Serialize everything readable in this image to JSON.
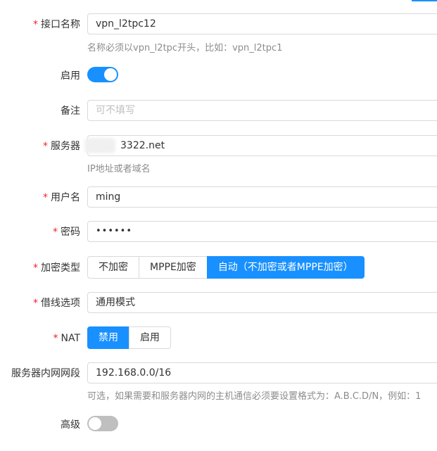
{
  "form": {
    "interface_name": {
      "label": "接口名称",
      "required": true,
      "value": "vpn_l2tpc12",
      "hint": "名称必须以vpn_l2tpc开头，比如：vpn_l2tpc1"
    },
    "enable": {
      "label": "启用",
      "required": false,
      "state": "on"
    },
    "remark": {
      "label": "备注",
      "required": false,
      "value": "",
      "placeholder": "可不填写"
    },
    "server": {
      "label": "服务器",
      "required": true,
      "value": "3322.net",
      "hint": "IP地址或者域名"
    },
    "username": {
      "label": "用户名",
      "required": true,
      "value": "ming"
    },
    "password": {
      "label": "密码",
      "required": true,
      "value": "••••••"
    },
    "encryption": {
      "label": "加密类型",
      "required": true,
      "options": [
        "不加密",
        "MPPE加密",
        "自动（不加密或者MPPE加密）"
      ],
      "selected": "自动（不加密或者MPPE加密）"
    },
    "line_option": {
      "label": "借线选项",
      "required": true,
      "value": "通用模式"
    },
    "nat": {
      "label": "NAT",
      "required": true,
      "options": [
        "禁用",
        "启用"
      ],
      "selected": "禁用"
    },
    "server_subnet": {
      "label": "服务器内网网段",
      "required": false,
      "value": "192.168.0.0/16",
      "hint": "可选，如果需要和服务器内网的主机通信必须要设置格式为：A.B.C.D/N，例如：1"
    },
    "advanced": {
      "label": "高级",
      "required": false,
      "state": "off"
    }
  },
  "required_marker": "*",
  "colors": {
    "primary": "#1890ff",
    "required": "#f5222d",
    "border": "#d9d9d9",
    "hint": "#8c8c8c",
    "placeholder": "#bfbfbf",
    "switch_off": "#bfbfbf"
  }
}
